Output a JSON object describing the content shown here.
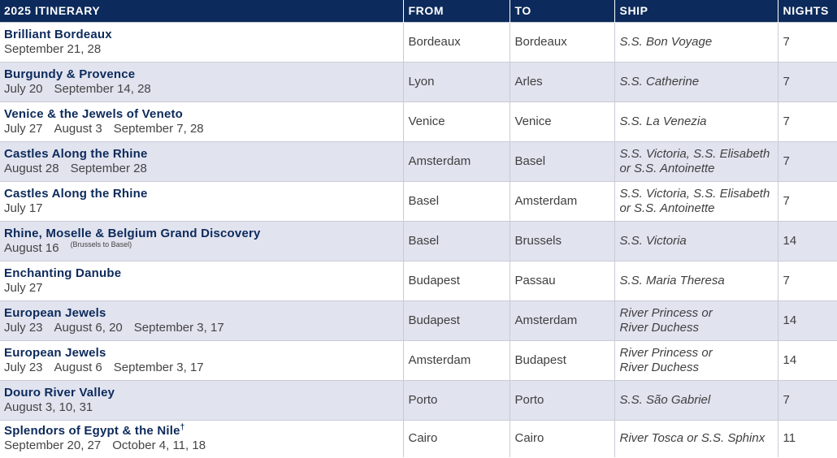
{
  "header": {
    "itinerary": "2025 ITINERARY",
    "from": "FROM",
    "to": "TO",
    "ship": "SHIP",
    "nights": "NIGHTS"
  },
  "rows": [
    {
      "name": "Brilliant Bordeaux",
      "dates": [
        "September 21, 28"
      ],
      "from": "Bordeaux",
      "to": "Bordeaux",
      "ship": [
        "S.S. Bon Voyage"
      ],
      "nights": "7"
    },
    {
      "name": "Burgundy & Provence",
      "dates": [
        "July 20",
        "September 14, 28"
      ],
      "from": "Lyon",
      "to": "Arles",
      "ship": [
        "S.S. Catherine"
      ],
      "nights": "7"
    },
    {
      "name": "Venice & the Jewels of Veneto",
      "dates": [
        "July 27",
        "August 3",
        "September 7, 28"
      ],
      "from": "Venice",
      "to": "Venice",
      "ship": [
        "S.S. La Venezia"
      ],
      "nights": "7"
    },
    {
      "name": "Castles Along the Rhine",
      "dates": [
        "August 28",
        "September 28"
      ],
      "from": "Amsterdam",
      "to": "Basel",
      "ship": [
        "S.S. Victoria, S.S. Elisabeth",
        "or S.S. Antoinette"
      ],
      "nights": "7"
    },
    {
      "name": "Castles Along the Rhine",
      "dates": [
        "July 17"
      ],
      "from": "Basel",
      "to": "Amsterdam",
      "ship": [
        "S.S. Victoria, S.S. Elisabeth",
        "or S.S. Antoinette"
      ],
      "nights": "7"
    },
    {
      "name": "Rhine, Moselle & Belgium Grand Discovery",
      "dates": [
        "August 16"
      ],
      "date_note": "(Brussels to Basel)",
      "from": "Basel",
      "to": "Brussels",
      "ship": [
        "S.S. Victoria"
      ],
      "nights": "14"
    },
    {
      "name": "Enchanting Danube",
      "dates": [
        "July 27"
      ],
      "from": "Budapest",
      "to": "Passau",
      "ship": [
        "S.S. Maria Theresa"
      ],
      "nights": "7"
    },
    {
      "name": "European Jewels",
      "dates": [
        "July 23",
        "August 6, 20",
        "September 3, 17"
      ],
      "from": "Budapest",
      "to": "Amsterdam",
      "ship": [
        "River Princess or",
        "River Duchess"
      ],
      "nights": "14"
    },
    {
      "name": "European Jewels",
      "dates": [
        "July 23",
        "August 6",
        "September 3, 17"
      ],
      "from": "Amsterdam",
      "to": "Budapest",
      "ship": [
        "River Princess or",
        "River Duchess"
      ],
      "nights": "14"
    },
    {
      "name": "Douro River Valley",
      "dates": [
        "August 3, 10, 31"
      ],
      "from": "Porto",
      "to": "Porto",
      "ship": [
        "S.S. São Gabriel"
      ],
      "nights": "7"
    },
    {
      "name": "Splendors of Egypt & the Nile",
      "name_mark": "†",
      "dates": [
        "September 20, 27",
        "October 4, 11, 18"
      ],
      "from": "Cairo",
      "to": "Cairo",
      "ship": [
        "River Tosca or S.S. Sphinx"
      ],
      "nights": "11"
    }
  ]
}
